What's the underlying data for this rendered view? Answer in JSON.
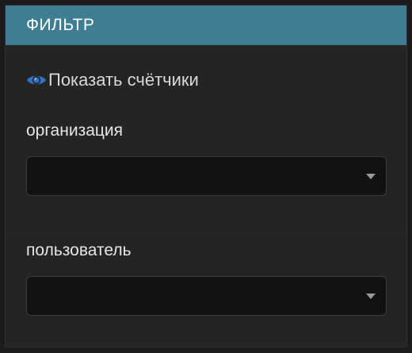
{
  "panel": {
    "title": "ФИЛЬТР"
  },
  "show_counters": {
    "label": "Показать счётчики",
    "icon": "eye-icon",
    "icon_color": "#2f73c9"
  },
  "filters": {
    "organization": {
      "label": "организация",
      "value": ""
    },
    "user": {
      "label": "пользователь",
      "value": ""
    }
  },
  "colors": {
    "header_bg": "#3f7d93",
    "panel_bg": "#242424",
    "select_bg": "#121212"
  }
}
